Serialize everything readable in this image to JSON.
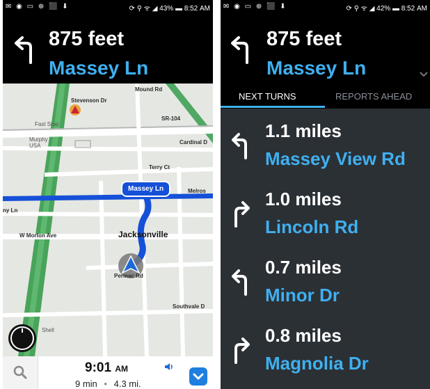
{
  "left": {
    "status": {
      "icons": "✉ ◉ ▭ ⊕ ⬛ ⬇",
      "right": "⟳ ⚲ ᯤ ◢ 43% ▬ 8:52 AM"
    },
    "header": {
      "distance": "875 feet",
      "street": "Massey Ln"
    },
    "map": {
      "labels": {
        "mound_rd": "Mound Rd",
        "stevenson_dr": "Stevenson Dr",
        "sr104": "SR-104",
        "fast_stop": "Fast Stop",
        "murphy": "Murphy USA",
        "cardinal": "Cardinal D",
        "terry_ct": "Terry Ct",
        "melrose": "Melros",
        "ny_ln": "ny Ln",
        "w_morton": "W Morton Ave",
        "jacksonville": "Jacksonville",
        "permac": "Permac Rd",
        "southvale": "Southvale D",
        "shell": "Shell"
      },
      "route_callout": "Massey Ln"
    },
    "bottom": {
      "eta_time": "9:01",
      "eta_ampm": "AM",
      "duration": "9 min",
      "separator": "•",
      "distance": "4.3 mi."
    }
  },
  "right": {
    "status": {
      "icons": "✉ ◉ ▭ ⊕ ⬛ ⬇",
      "right": "⟳ ⚲ ᯤ ◢ 42% ▬ 8:52 AM"
    },
    "header": {
      "distance": "875 feet",
      "street": "Massey Ln"
    },
    "tabs": [
      {
        "label": "NEXT TURNS"
      },
      {
        "label": "REPORTS AHEAD"
      }
    ],
    "turns": [
      {
        "distance": "1.1 miles",
        "street": "Massey View Rd",
        "direction": "left"
      },
      {
        "distance": "1.0 miles",
        "street": "Lincoln Rd",
        "direction": "right"
      },
      {
        "distance": "0.7 miles",
        "street": "Minor Dr",
        "direction": "left"
      },
      {
        "distance": "0.8 miles",
        "street": "Magnolia Dr",
        "direction": "right"
      }
    ]
  },
  "colors": {
    "accent": "#3fb0f0",
    "route": "#1550d8",
    "header_bg": "#000000",
    "list_bg": "#2b3035"
  }
}
